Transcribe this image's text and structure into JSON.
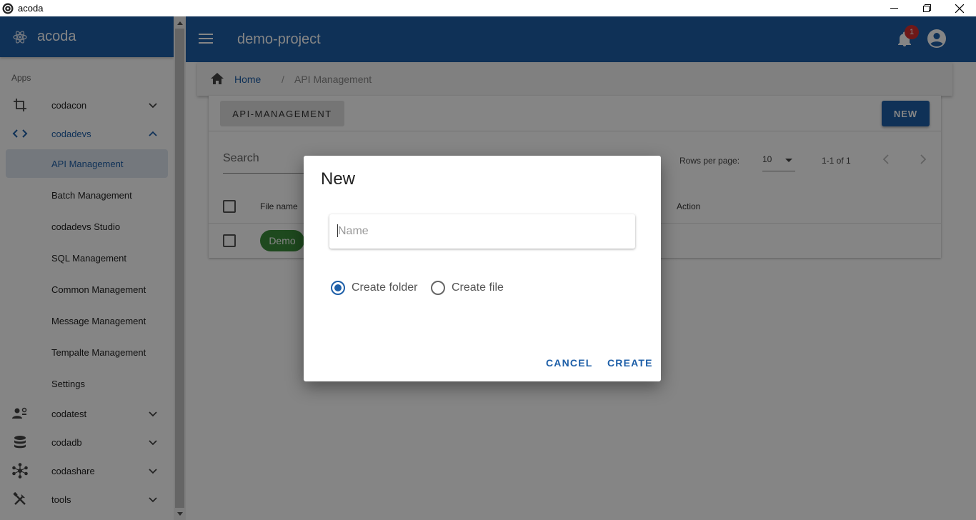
{
  "window": {
    "title": "acoda"
  },
  "sidebar": {
    "brand": "acoda",
    "apps_label": "Apps",
    "items": [
      {
        "label": "codacon",
        "icon": "crop-icon"
      },
      {
        "label": "codadevs",
        "icon": "code-icon",
        "expanded": true
      },
      {
        "label": "codatest",
        "icon": "people-settings-icon"
      },
      {
        "label": "codadb",
        "icon": "database-icon"
      },
      {
        "label": "codashare",
        "icon": "share-network-icon"
      },
      {
        "label": "tools",
        "icon": "tools-icon"
      }
    ],
    "subitems": [
      {
        "label": "API Management",
        "active": true
      },
      {
        "label": "Batch Management"
      },
      {
        "label": "codadevs Studio"
      },
      {
        "label": "SQL Management"
      },
      {
        "label": "Common Management"
      },
      {
        "label": "Message Management"
      },
      {
        "label": "Tempalte Management"
      },
      {
        "label": "Settings"
      }
    ]
  },
  "appbar": {
    "project": "demo-project",
    "notification_count": "1"
  },
  "breadcrumb": {
    "home": "Home",
    "separator": "/",
    "current": "API Management"
  },
  "card": {
    "tab_label": "API-MANAGEMENT",
    "new_label": "NEW",
    "search_placeholder": "Search",
    "rows_per_page_label": "Rows per page:",
    "rows_per_page_value": "10",
    "range": "1-1 of 1",
    "columns": {
      "file_name": "File name",
      "action": "Action"
    },
    "rows": [
      {
        "file_name": "Demo"
      }
    ]
  },
  "dialog": {
    "title": "New",
    "name_placeholder": "Name",
    "name_value": "",
    "options": [
      {
        "label": "Create folder",
        "checked": true
      },
      {
        "label": "Create file",
        "checked": false
      }
    ],
    "cancel_label": "CANCEL",
    "create_label": "CREATE"
  },
  "colors": {
    "primary": "#1e5fa8",
    "badge": "#d32f2f",
    "chip_green": "#3b8c3b"
  }
}
